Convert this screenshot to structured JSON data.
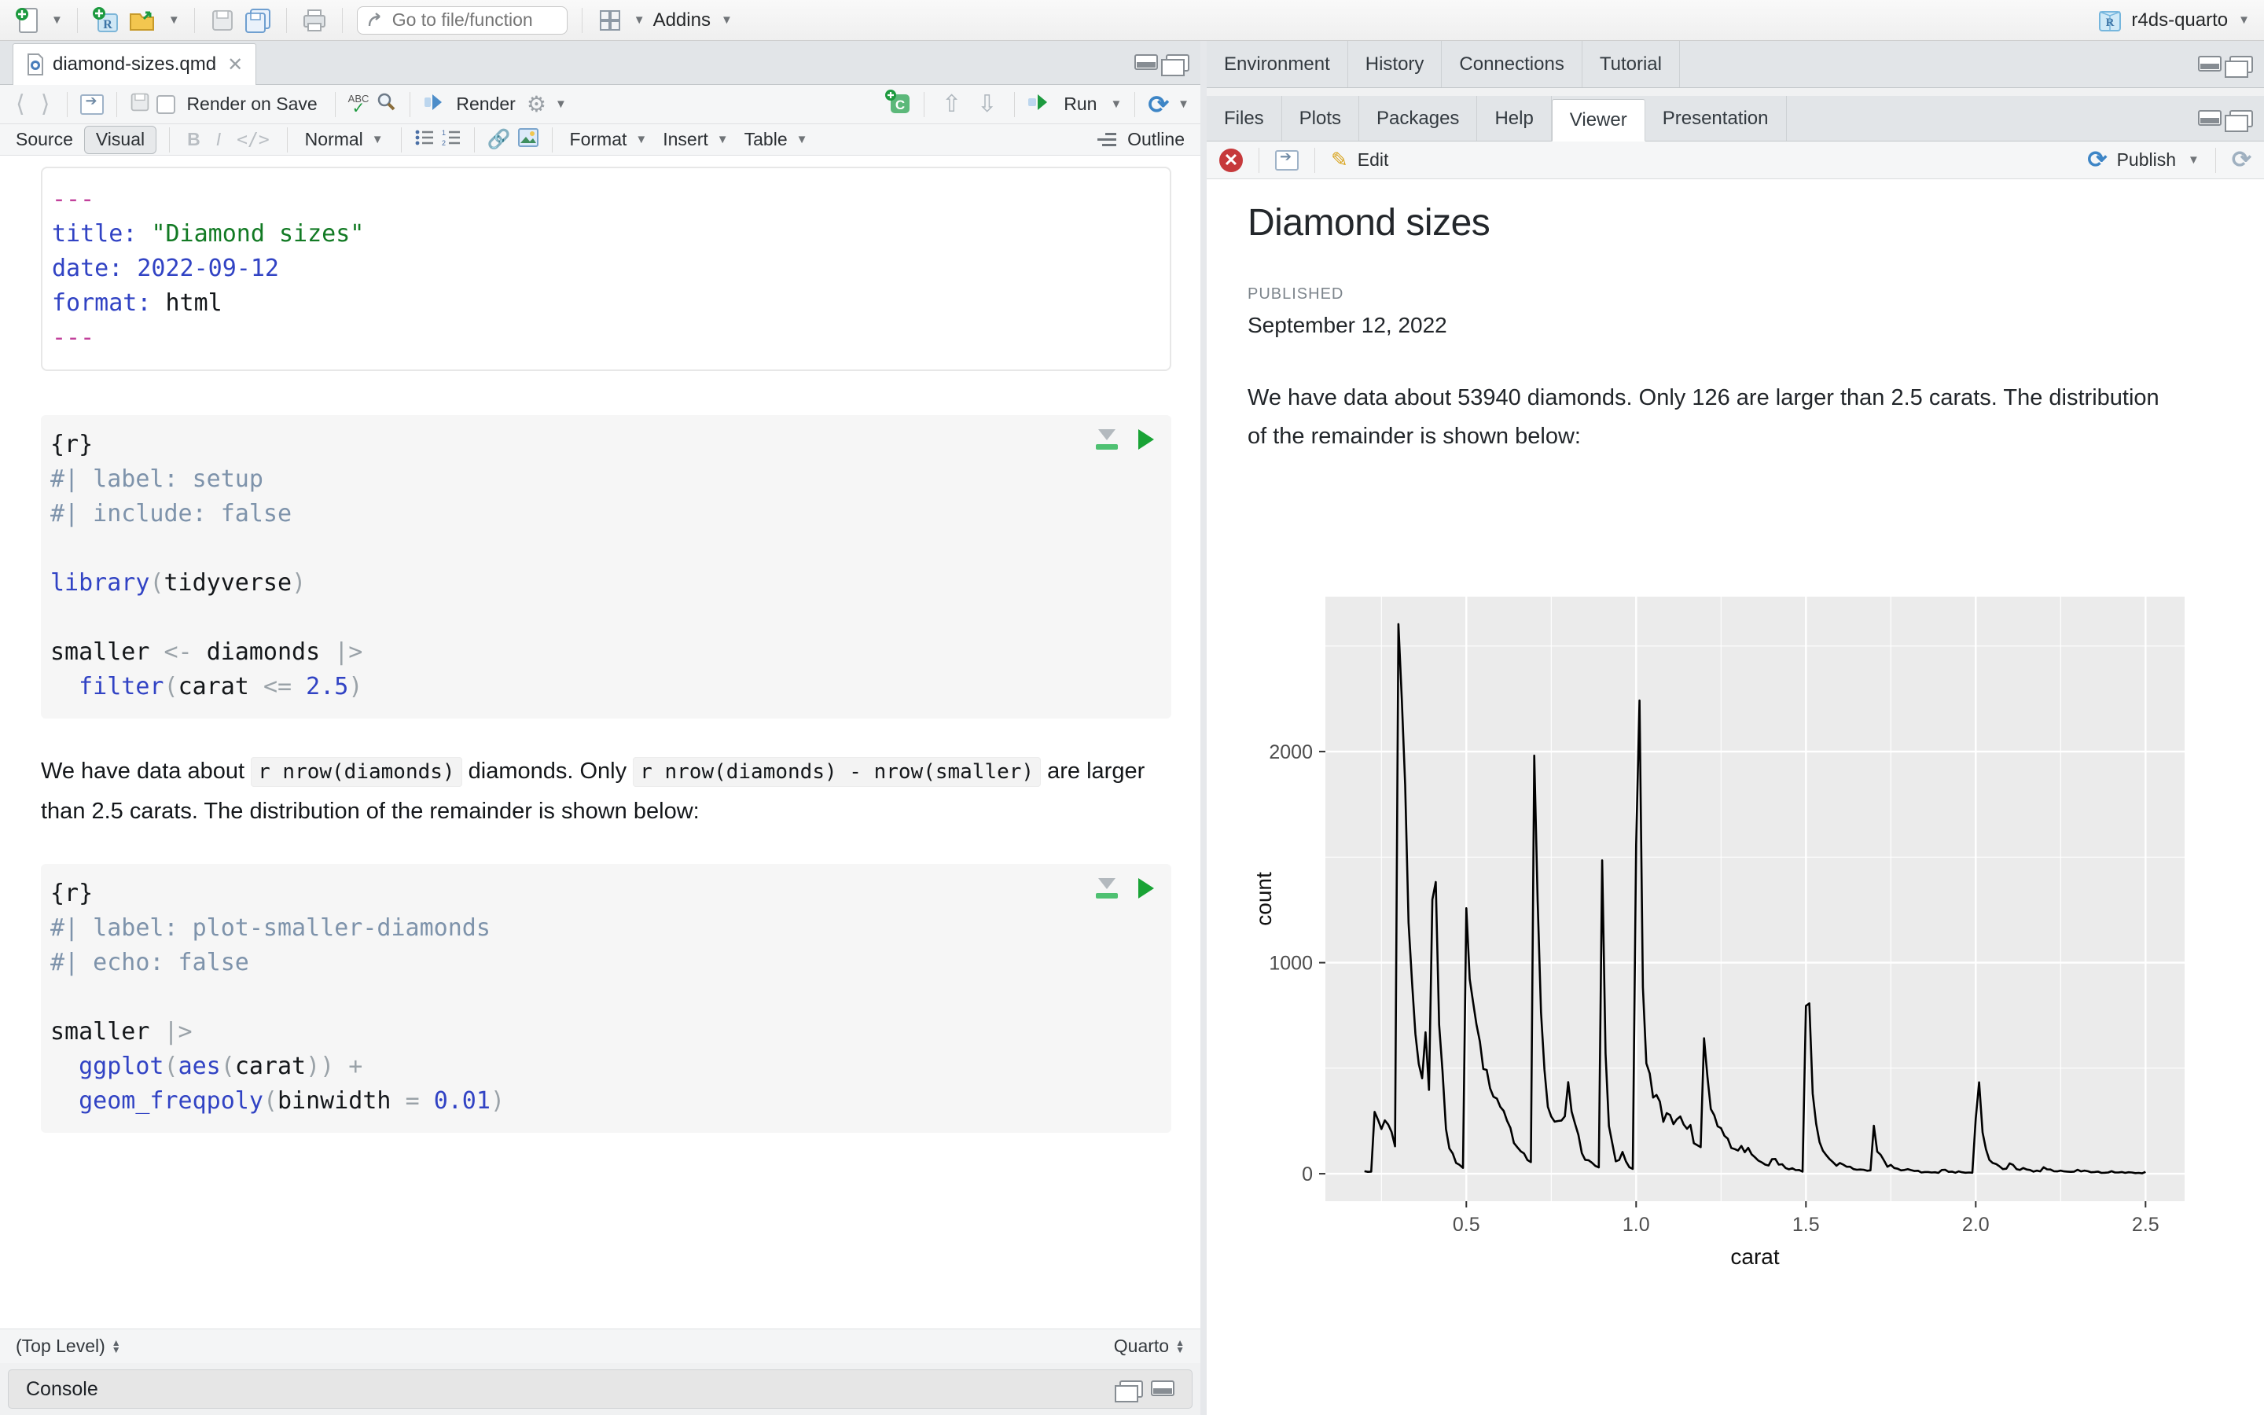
{
  "toolbar": {
    "goto_placeholder": "Go to file/function",
    "addins_label": "Addins",
    "project_name": "r4ds-quarto"
  },
  "editor": {
    "tab_title": "diamond-sizes.qmd",
    "toolbar1": {
      "render_on_save": "Render on Save",
      "render": "Render",
      "run": "Run"
    },
    "toolbar2": {
      "source": "Source",
      "visual": "Visual",
      "bold": "B",
      "italic": "I",
      "code": "</>",
      "paragraph_style": "Normal",
      "format": "Format",
      "insert": "Insert",
      "table": "Table",
      "outline": "Outline"
    },
    "yaml_lines": [
      [
        [
          "---",
          "y"
        ]
      ],
      [
        [
          "title: ",
          "k"
        ],
        [
          "\"Diamond sizes\"",
          "s"
        ]
      ],
      [
        [
          "date: ",
          "k"
        ],
        [
          "2022-09-12",
          "n"
        ]
      ],
      [
        [
          "format: ",
          "k"
        ],
        [
          "html",
          "p"
        ]
      ],
      [
        [
          "---",
          "y"
        ]
      ]
    ],
    "chunk1_lines": [
      [
        [
          "{r}",
          "p"
        ]
      ],
      [
        [
          "#| label: setup",
          "c"
        ]
      ],
      [
        [
          "#| include: false",
          "c"
        ]
      ],
      [
        [
          "",
          ""
        ]
      ],
      [
        [
          "library",
          "k"
        ],
        [
          "(",
          "o"
        ],
        [
          "tidyverse",
          "p"
        ],
        [
          ")",
          "o"
        ]
      ],
      [
        [
          "",
          ""
        ]
      ],
      [
        [
          "smaller ",
          "p"
        ],
        [
          "<- ",
          "o"
        ],
        [
          "diamonds ",
          "p"
        ],
        [
          "|>",
          "o"
        ]
      ],
      [
        [
          "  filter",
          "k"
        ],
        [
          "(",
          "o"
        ],
        [
          "carat ",
          "p"
        ],
        [
          "<= ",
          "o"
        ],
        [
          "2.5",
          "n"
        ],
        [
          ")",
          "o"
        ]
      ]
    ],
    "prose_segments": [
      {
        "t": "We have data about ",
        "code": false
      },
      {
        "t": "r nrow(diamonds)",
        "code": true
      },
      {
        "t": " diamonds. Only ",
        "code": false
      },
      {
        "t": "r nrow(diamonds) - nrow(smaller)",
        "code": true
      },
      {
        "t": " are larger than 2.5 carats. The distribution of the remainder is shown below:",
        "code": false
      }
    ],
    "chunk2_lines": [
      [
        [
          "{r}",
          "p"
        ]
      ],
      [
        [
          "#| label: plot-smaller-diamonds",
          "c"
        ]
      ],
      [
        [
          "#| echo: false",
          "c"
        ]
      ],
      [
        [
          "",
          ""
        ]
      ],
      [
        [
          "smaller ",
          "p"
        ],
        [
          "|>",
          "o"
        ]
      ],
      [
        [
          "  ggplot",
          "k"
        ],
        [
          "(",
          "o"
        ],
        [
          "aes",
          "k"
        ],
        [
          "(",
          "o"
        ],
        [
          "carat",
          "p"
        ],
        [
          "))",
          "o"
        ],
        [
          " +",
          "o"
        ]
      ],
      [
        [
          "  geom_freqpoly",
          "k"
        ],
        [
          "(",
          "o"
        ],
        [
          "binwidth ",
          "p"
        ],
        [
          "= ",
          "o"
        ],
        [
          "0.01",
          "n"
        ],
        [
          ")",
          "o"
        ]
      ]
    ],
    "status_left": "(Top Level)",
    "status_right": "Quarto",
    "console_title": "Console"
  },
  "right": {
    "env_tabs": [
      "Environment",
      "History",
      "Connections",
      "Tutorial"
    ],
    "files_tabs": [
      "Files",
      "Plots",
      "Packages",
      "Help",
      "Viewer",
      "Presentation"
    ],
    "files_active_index": 4,
    "viewer_toolbar": {
      "edit": "Edit",
      "publish": "Publish"
    },
    "doc": {
      "title": "Diamond sizes",
      "published_label": "PUBLISHED",
      "date": "September 12, 2022",
      "body": "We have data about 53940 diamonds. Only 126 are larger than 2.5 carats. The distribution of the remainder is shown below:"
    }
  },
  "chart_data": {
    "type": "line",
    "title": "",
    "xlabel": "carat",
    "ylabel": "count",
    "x_ticks": [
      0.5,
      1.0,
      1.5,
      2.0,
      2.5
    ],
    "x_minor_ticks": [
      0.25,
      0.75,
      1.25,
      1.75,
      2.25
    ],
    "y_ticks": [
      0,
      1000,
      2000
    ],
    "y_minor_ticks": [
      500,
      1500,
      2500
    ],
    "x_domain": [
      0.085,
      2.615
    ],
    "y_domain": [
      -130,
      2734
    ],
    "grid": true,
    "legend": "none",
    "panel_color": "#ebebeb",
    "line_color": "#000000",
    "x_start": 0.2,
    "x_step": 0.01,
    "counts": [
      12,
      9,
      10,
      293,
      255,
      212,
      253,
      233,
      198,
      130,
      2604,
      2249,
      1840,
      1189,
      910,
      663,
      520,
      452,
      670,
      397,
      1299,
      1382,
      706,
      486,
      212,
      120,
      96,
      51,
      42,
      28,
      1258,
      922,
      813,
      707,
      625,
      496,
      492,
      405,
      365,
      356,
      317,
      298,
      251,
      217,
      146,
      126,
      107,
      96,
      65,
      55,
      1981,
      1294,
      765,
      492,
      317,
      271,
      247,
      250,
      252,
      272,
      434,
      295,
      238,
      184,
      98,
      66,
      64,
      52,
      37,
      30,
      1485,
      570,
      226,
      142,
      59,
      65,
      103,
      59,
      31,
      23,
      1558,
      2242,
      883,
      523,
      475,
      361,
      373,
      342,
      246,
      287,
      278,
      235,
      258,
      271,
      233,
      213,
      231,
      145,
      135,
      126,
      642,
      460,
      307,
      277,
      225,
      216,
      180,
      166,
      122,
      117,
      110,
      132,
      102,
      123,
      92,
      78,
      62,
      54,
      43,
      39,
      69,
      70,
      43,
      45,
      27,
      21,
      26,
      17,
      18,
      10,
      795,
      807,
      380,
      237,
      150,
      109,
      88,
      69,
      54,
      38,
      51,
      43,
      33,
      33,
      22,
      19,
      20,
      19,
      14,
      16,
      227,
      105,
      90,
      62,
      33,
      42,
      27,
      24,
      16,
      18,
      22,
      17,
      13,
      14,
      6,
      8,
      8,
      6,
      7,
      4,
      18,
      19,
      9,
      10,
      5,
      11,
      7,
      5,
      6,
      5,
      261,
      433,
      196,
      116,
      66,
      51,
      46,
      35,
      22,
      24,
      49,
      42,
      22,
      18,
      27,
      20,
      18,
      10,
      15,
      11,
      31,
      21,
      20,
      12,
      11,
      15,
      11,
      10,
      9,
      10,
      19,
      11,
      15,
      12,
      7,
      8,
      10,
      4,
      5,
      6,
      12,
      6,
      6,
      8,
      4,
      7,
      6,
      3,
      4,
      2,
      9
    ]
  }
}
